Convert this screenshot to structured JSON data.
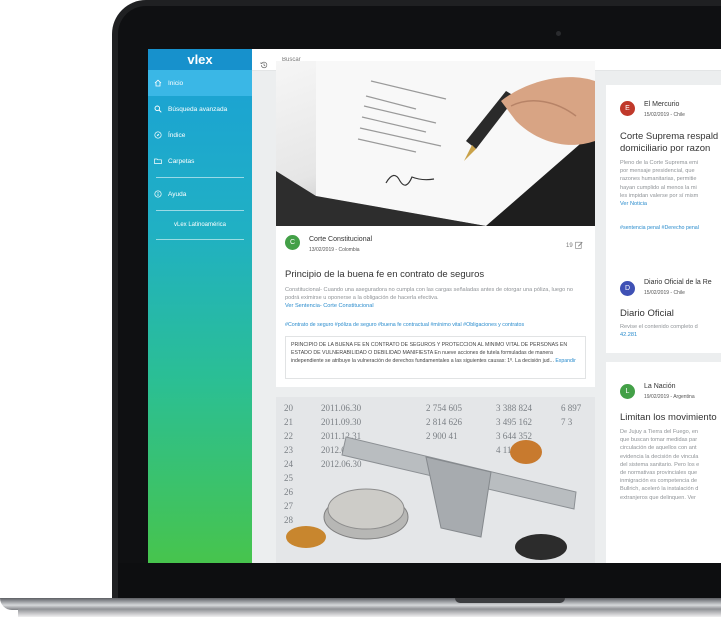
{
  "app": {
    "logo": "vlex"
  },
  "sidebar": {
    "items": [
      {
        "label": "Inicio",
        "icon": "home-icon"
      },
      {
        "label": "Búsqueda avanzada",
        "icon": "search-icon"
      },
      {
        "label": "Índice",
        "icon": "compass-icon"
      },
      {
        "label": "Carpetas",
        "icon": "folder-icon"
      }
    ],
    "help": {
      "label": "Ayuda",
      "icon": "info-icon"
    },
    "region": "vLex Latinoamérica"
  },
  "topbar": {
    "search_placeholder": "Buscar",
    "history_icon": "history-icon"
  },
  "feed": {
    "main": {
      "avatar": "C",
      "source": "Corte Constitucional",
      "meta": "13/02/2019 - Colombia",
      "count": "19",
      "title": "Principio de la buena fe en contrato de seguros",
      "body": "Constitucional- Cuando una aseguradora no cumpla con las cargas señaladas antes de otorgar una póliza, luego no podrá eximirse u oponerse a la obligación de hacerla efectiva.",
      "link": "Ver Sentencia- Corte Constitucional",
      "tags": "#Contrato de seguro #póliza de seguro #buena fe contractual #mínimo vital #Obligaciones y contratos",
      "quote": "PRINCIPIO DE LA BUENA FE EN CONTRATO DE SEGUROS Y PROTECCION AL MINIMO VITAL DE PERSONAS EN ESTADO DE VULNERABILIDAD O DEBILIDAD MANIFIESTA En nueve acciones de tutela formuladas de manera independiente se atribuye la vulneración de derechos fundamentales a las siguientes causas: 1º. La decisión jud...",
      "expand": "Expandir"
    },
    "side": [
      {
        "avatar": "E",
        "color": "#c0392b",
        "source": "El Mercurio",
        "meta": "15/02/2019 - Chile",
        "title_l1": "Corte Suprema respald",
        "title_l2": "domiciliario por razon",
        "body_lines": [
          "Pleno de la Corte Suprema emi",
          "por mensaje presidencial, que",
          "razones humanitarias, permitie",
          "hayan cumplido al menos la mi",
          "les impidan valerse por sí mism"
        ],
        "link": "Ver Noticia",
        "tags": "#sentencia penal #Derecho penal"
      },
      {
        "avatar": "D",
        "color": "#3f51b5",
        "source": "Diario Oficial de la Re",
        "meta": "15/02/2019 - Chile",
        "title_l1": "Diario Oficial",
        "body_lines": [
          "Revise el contenido completo d"
        ],
        "link": "42.281"
      },
      {
        "avatar": "L",
        "color": "#43a047",
        "source": "La Nación",
        "meta": "19/02/2019 - Argentina",
        "title_l1": "Limitan los movimiento",
        "body_lines": [
          "De Jujuy a Tierra del Fuego, en",
          "que buscan tomar medidas par",
          "circulación de aquellos con ant",
          "evidencia la decisión de vincula",
          "del sistema sanitario. Pero los e",
          "de normativas provinciales que",
          "inmigración es competencia de",
          "Bullrich, aceleró la instalación d",
          "extranjeros que delinquen. Ver"
        ]
      }
    ]
  }
}
